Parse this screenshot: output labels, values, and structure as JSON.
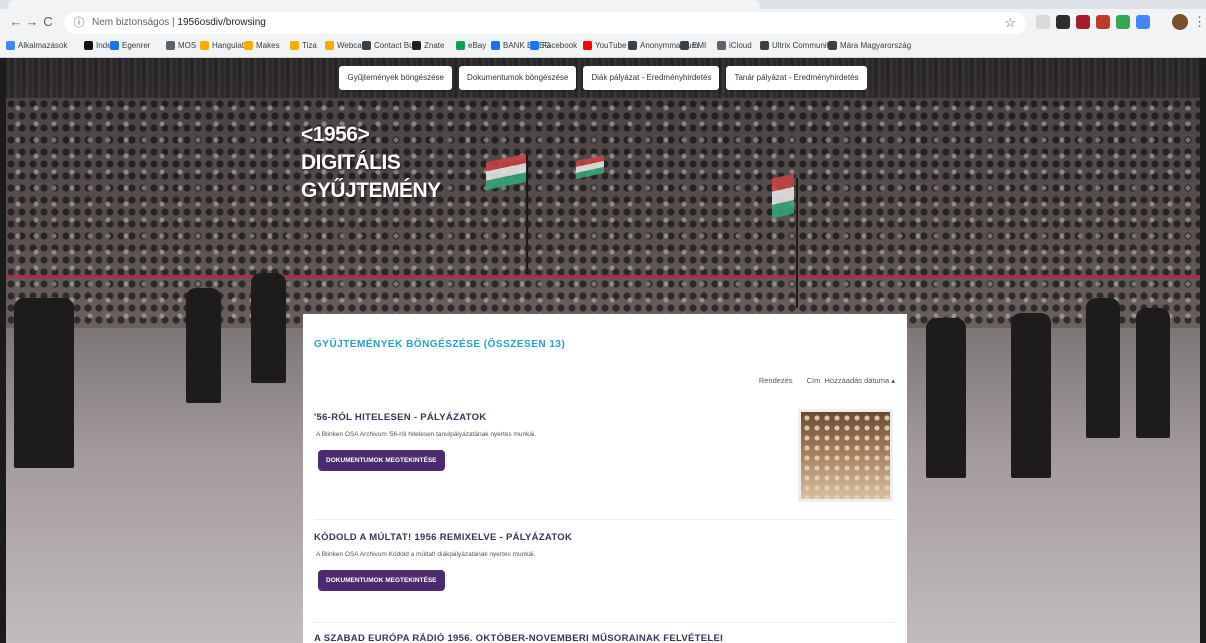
{
  "browser": {
    "back": "←",
    "forward": "→",
    "reload": "C",
    "home": "⌂",
    "info_icon": "ⓘ",
    "url_host": "Nem biztonságos",
    "url_path": "1956osdiv/browsing",
    "star_icon": "☆",
    "menu_icon": "⋮",
    "bookmarks": [
      {
        "label": "Alkalmazások",
        "color": "#4285f4"
      },
      {
        "label": "Index",
        "color": "#111111"
      },
      {
        "label": "Egenrer",
        "color": "#1a73e8"
      },
      {
        "label": "MOS",
        "color": "#5f6368"
      },
      {
        "label": "Hangulatig",
        "color": "#f9ab00"
      },
      {
        "label": "Makes",
        "color": "#f9ab00"
      },
      {
        "label": "Tiza",
        "color": "#f9ab00"
      },
      {
        "label": "Webcam",
        "color": "#f9ab00"
      },
      {
        "label": "Contact Bus",
        "color": "#3c4043"
      },
      {
        "label": "Znate",
        "color": "#202124"
      },
      {
        "label": "eBay",
        "color": "#0f9d58"
      },
      {
        "label": "BANK EMEG",
        "color": "#1a73e8"
      },
      {
        "label": "Facebook",
        "color": "#1877f2"
      },
      {
        "label": "YouTube",
        "color": "#ff0000"
      },
      {
        "label": "Anonymmatrium",
        "color": "#3c4043"
      },
      {
        "label": "EMI",
        "color": "#3c4043"
      },
      {
        "label": "iCloud",
        "color": "#5f6368"
      },
      {
        "label": "Ultrix Community",
        "color": "#3c4043"
      },
      {
        "label": "Mára Magyarország",
        "color": "#3c4043"
      }
    ],
    "extension_colors": [
      "#d9d9d9",
      "#2d2d2d",
      "#a51d2d",
      "#c0392b",
      "#34a853",
      "#4285f4"
    ]
  },
  "nav": {
    "buttons": [
      "Gyűjtemények böngészése",
      "Dokumentumok böngészése",
      "Diák pályázat - Eredményhirdetés",
      "Tanár pályázat - Eredményhirdetés"
    ]
  },
  "logo": {
    "line1": "<1956>",
    "line2": "DIGITÁLIS",
    "line3": "GYŰJTEMÉNY"
  },
  "panel": {
    "title": "GYŰJTEMÉNYEK BÖNGÉSZÉSE (ÖSSZESEN 13)",
    "sort_label": "Rendezés",
    "sort_title": "Cím",
    "sort_date": "Hozzáadás dátuma ▴",
    "entries": [
      {
        "title": "'56-RÓL HITELESEN - PÁLYÁZATOK",
        "desc": "A Blinken OSA Archivum '56-ról hitelesen tanulpályázatának nyertes munkái.",
        "button": "DOKUMENTUMOK MEGTEKINTÉSE"
      },
      {
        "title": "KÓDOLD A MÚLTAT! 1956 REMIXELVE - PÁLYÁZATOK",
        "desc": "A Blinken OSA Archivum Kódold a múltat! diákpályázatának nyertes munkái.",
        "button": "DOKUMENTUMOK MEGTEKINTÉSE"
      }
    ],
    "third_title": "A SZABAD EURÓPA RÁDIÓ 1956. OKTÓBER-NOVEMBERI MŰSORAINAK FELVÉTELEI"
  }
}
